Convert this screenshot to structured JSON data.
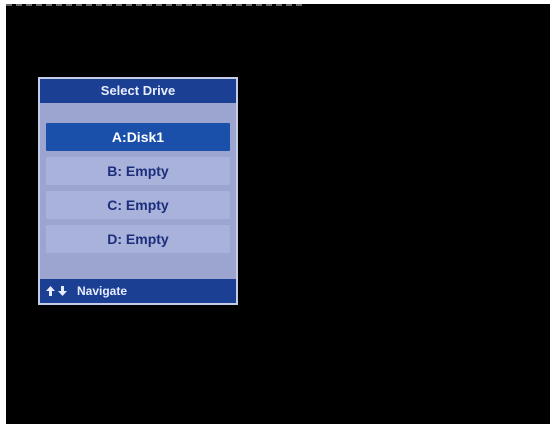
{
  "dialog": {
    "title": "Select Drive",
    "drives": [
      {
        "label": "A:Disk1",
        "selected": true
      },
      {
        "label": "B: Empty",
        "selected": false
      },
      {
        "label": "C: Empty",
        "selected": false
      },
      {
        "label": "D: Empty",
        "selected": false
      }
    ],
    "footer": {
      "hint_label": "Navigate",
      "icons": [
        "up-arrow-icon",
        "down-arrow-icon"
      ]
    }
  },
  "colors": {
    "background": "#000000",
    "header_bar": "#1b3f93",
    "panel": "#9ca5cf",
    "item": "#a9b2da",
    "selected_item": "#1b50aa",
    "item_text": "#1b2e7c"
  }
}
